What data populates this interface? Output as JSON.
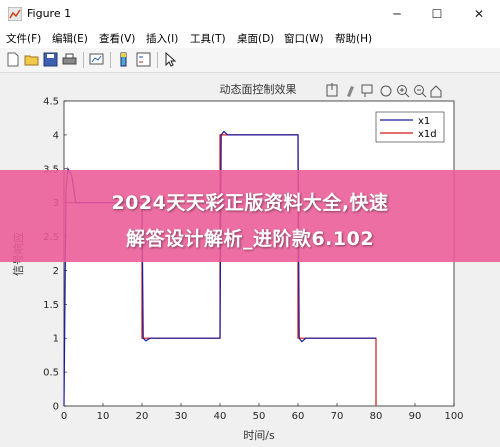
{
  "window": {
    "title": "Figure 1",
    "minimize": "─",
    "maximize": "☐",
    "close": "✕"
  },
  "menu": [
    {
      "label": "文件(F)"
    },
    {
      "label": "编辑(E)"
    },
    {
      "label": "查看(V)"
    },
    {
      "label": "插入(I)"
    },
    {
      "label": "工具(T)"
    },
    {
      "label": "桌面(D)"
    },
    {
      "label": "窗口(W)"
    },
    {
      "label": "帮助(H)"
    }
  ],
  "toolbar": {
    "icons": [
      "new-figure-icon",
      "open-icon",
      "save-icon",
      "print-icon",
      "link-plot-icon",
      "colorbar-icon",
      "legend-icon",
      "pointer-icon"
    ]
  },
  "axes_toolbar": {
    "icons": [
      "export-icon",
      "brush-icon",
      "data-tips-icon",
      "pan-icon",
      "zoom-in-icon",
      "zoom-out-icon",
      "home-icon"
    ]
  },
  "overlay": {
    "line1": "2024天天彩正版资料大全,快速",
    "line2": "解答设计解析_进阶款6.102"
  },
  "colors": {
    "x1": "#1a1a9c",
    "x1d": "#d01818",
    "banner": "#eb5a96"
  },
  "chart_data": {
    "type": "line",
    "title": "动态面控制效果",
    "xlabel": "时间/s",
    "ylabel": "信号响应",
    "xlim": [
      0,
      100
    ],
    "ylim": [
      0,
      4.5
    ],
    "xticks": [
      "0",
      "10",
      "20",
      "30",
      "40",
      "50",
      "60",
      "70",
      "80",
      "90",
      "100"
    ],
    "yticks": [
      "0",
      "0.5",
      "1",
      "1.5",
      "2",
      "2.5",
      "3",
      "3.5",
      "4",
      "4.5"
    ],
    "grid": false,
    "legend_position": "top-right",
    "series": [
      {
        "name": "x1",
        "x": [
          0,
          0.5,
          1,
          2,
          3,
          20,
          20.3,
          21,
          22,
          40,
          40.3,
          41,
          42,
          60,
          60.3,
          61,
          62,
          80
        ],
        "y": [
          0,
          3.2,
          3.5,
          3.4,
          3.0,
          3.0,
          1.0,
          0.96,
          1.0,
          1.0,
          4.0,
          4.05,
          4.0,
          4.0,
          1.0,
          0.95,
          1.0,
          1.0
        ]
      },
      {
        "name": "x1d",
        "x": [
          0,
          20,
          20,
          40,
          40,
          60,
          60,
          80,
          80
        ],
        "y": [
          3.0,
          3.0,
          1.0,
          1.0,
          4.0,
          4.0,
          1.0,
          1.0,
          0.0
        ]
      }
    ]
  }
}
